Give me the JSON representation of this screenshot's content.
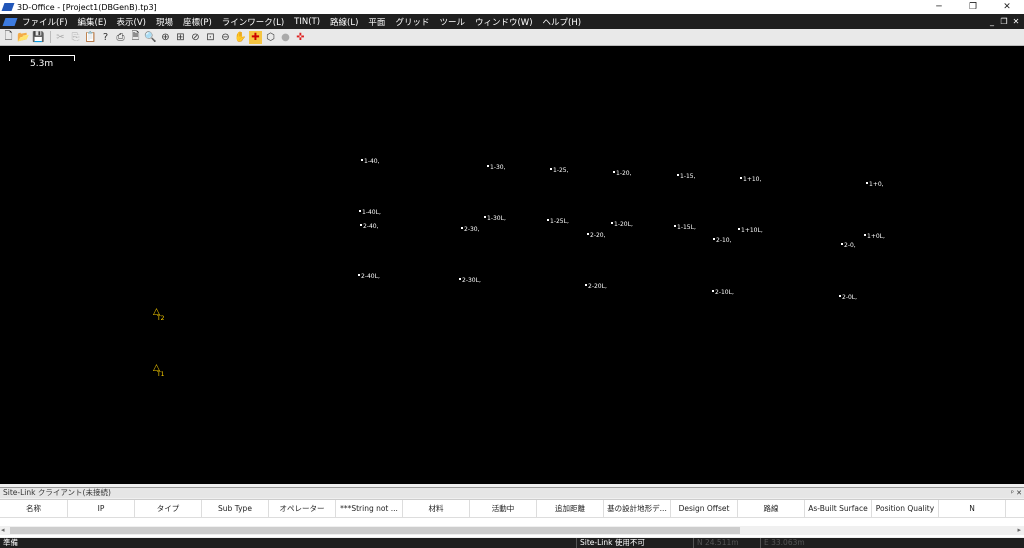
{
  "window": {
    "title": "3D-Office - [Project1(DBGenB).tp3]",
    "minimize": "─",
    "maximize": "❐",
    "close": "✕"
  },
  "menu": [
    "ファイル(F)",
    "編集(E)",
    "表示(V)",
    "現場",
    "座標(P)",
    "ラインワーク(L)",
    "TIN(T)",
    "路線(L)",
    "平面",
    "グリッド",
    "ツール",
    "ウィンドウ(W)",
    "ヘルプ(H)"
  ],
  "doc_controls": {
    "minimize": "_",
    "restore": "❐",
    "close": "✕"
  },
  "toolbar": [
    "new-icon",
    "open-icon",
    "save-icon",
    "cut-icon",
    "copy-icon",
    "paste-icon",
    "properties-icon",
    "print-icon",
    "print-preview-icon",
    "zoom-icon",
    "zoom-in-icon",
    "zoom-extents-icon",
    "zoom-previous-icon",
    "zoom-window-icon",
    "zoom-out-icon",
    "pan-icon",
    "crosshair-icon",
    "polygon-icon",
    "circle-icon",
    "target-icon"
  ],
  "scale": {
    "label": "5.3m"
  },
  "points": [
    {
      "label": "1-40,"
    },
    {
      "label": "1-30,"
    },
    {
      "label": "1-25,"
    },
    {
      "label": "1-20,"
    },
    {
      "label": "1-15,"
    },
    {
      "label": "1+10,"
    },
    {
      "label": "1+0,"
    },
    {
      "label": "1-40L,"
    },
    {
      "label": "2-40,"
    },
    {
      "label": "1-30L,"
    },
    {
      "label": "2-30,"
    },
    {
      "label": "1-25L,"
    },
    {
      "label": "1-20L,"
    },
    {
      "label": "2-20,"
    },
    {
      "label": "1-15L,"
    },
    {
      "label": "1+10L,"
    },
    {
      "label": "2-10,"
    },
    {
      "label": "1+0L,"
    },
    {
      "label": "2-0,"
    },
    {
      "label": "2-40L,"
    },
    {
      "label": "2-30L,"
    },
    {
      "label": "2-20L,"
    },
    {
      "label": "2-10L,"
    },
    {
      "label": "2-0L,"
    }
  ],
  "stations": [
    {
      "label": "T2"
    },
    {
      "label": "T1"
    }
  ],
  "panel": {
    "title": "Site-Link クライアント(未接続)",
    "pin": "ᵖ",
    "close": "✕"
  },
  "columns": [
    "名称",
    "IP",
    "タイプ",
    "Sub Type",
    "オペレーター",
    "***String not ...",
    "材料",
    "活動中",
    "追加距離",
    "基の設計地形デ...",
    "Design Offset",
    "路線",
    "As-Built Surface",
    "Position Quality",
    "N"
  ],
  "status": {
    "ready": "準備",
    "sitelink": "Site-Link 使用不可",
    "n": "N 24.511m",
    "e": "E 33.063m"
  }
}
